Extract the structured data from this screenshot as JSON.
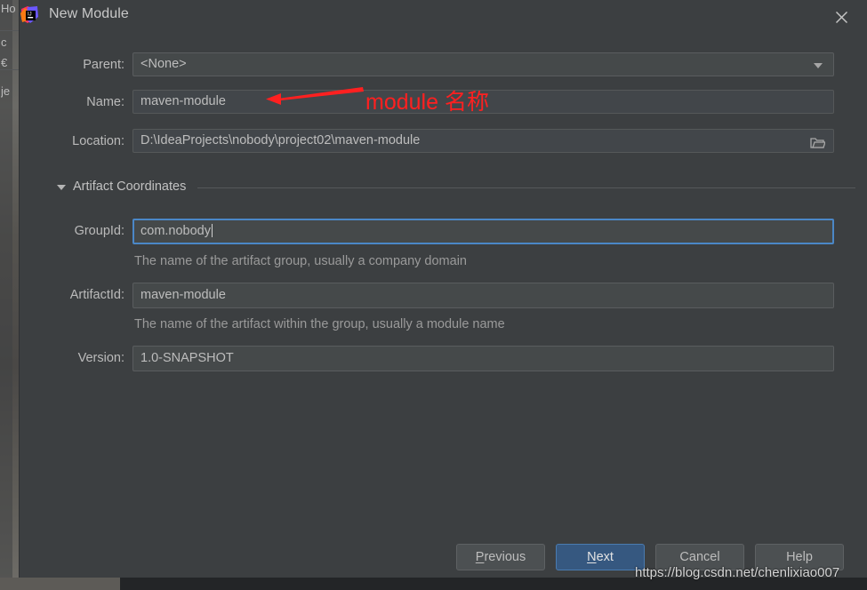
{
  "window": {
    "title": "New Module",
    "app_icon": "intellij-idea-icon",
    "close_icon": "close-icon"
  },
  "backdrop": {
    "fragments": [
      "Ho",
      "c",
      "€",
      "je"
    ]
  },
  "form": {
    "rows": [
      {
        "label": "Parent:",
        "value": "<None>",
        "type": "combobox",
        "icon": "chevron-down-icon",
        "name": "parent"
      },
      {
        "label": "Name:",
        "value": "maven-module",
        "type": "text",
        "name": "name"
      },
      {
        "label": "Location:",
        "value": "D:\\IdeaProjects\\nobody\\project02\\maven-module",
        "type": "path",
        "icon": "folder-browse-icon",
        "name": "location"
      }
    ]
  },
  "section": {
    "title": "Artifact Coordinates",
    "expanded": true,
    "toggle_icon": "triangle-down-icon",
    "fields": [
      {
        "label": "GroupId:",
        "value": "com.nobody",
        "hint": "The name of the artifact group, usually a company domain",
        "focused": true,
        "name": "groupid"
      },
      {
        "label": "ArtifactId:",
        "value": "maven-module",
        "hint": "The name of the artifact within the group, usually a module name",
        "focused": false,
        "name": "artifactid"
      },
      {
        "label": "Version:",
        "value": "1.0-SNAPSHOT",
        "hint": "",
        "focused": false,
        "name": "version"
      }
    ]
  },
  "annotation": {
    "text": "module 名称",
    "color": "#ff2020",
    "arrow_icon": "left-arrow-annotation"
  },
  "buttons": [
    {
      "label": "Previous",
      "mnemonic": "P",
      "default": false,
      "name": "previous"
    },
    {
      "label": "Next",
      "mnemonic": "N",
      "default": true,
      "name": "next"
    },
    {
      "label": "Cancel",
      "mnemonic": "",
      "default": false,
      "name": "cancel"
    },
    {
      "label": "Help",
      "mnemonic": "",
      "default": false,
      "name": "help"
    }
  ],
  "watermark": {
    "text": "https://blog.csdn.net/chenlixiao007"
  },
  "colors": {
    "dialog_bg": "#3c3f41",
    "field_bg": "#45494a",
    "focus_border": "#4b87c7",
    "default_button": "#365880",
    "annotation": "#ff2020"
  }
}
